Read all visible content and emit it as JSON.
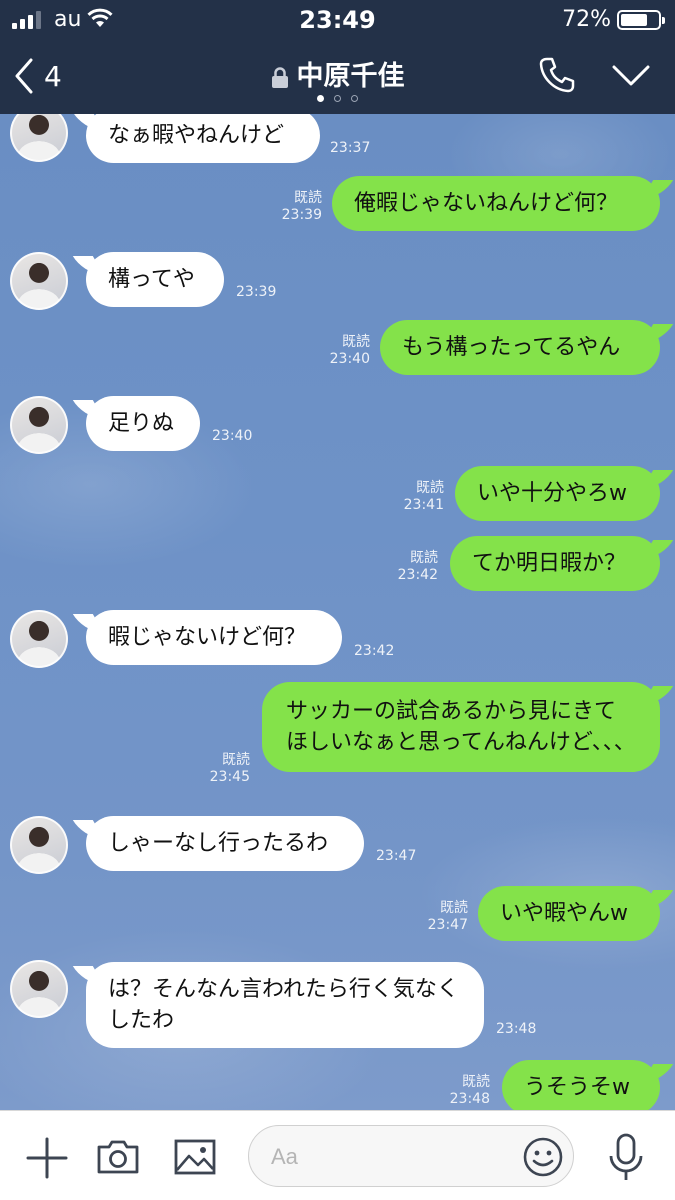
{
  "status_bar": {
    "carrier": "au",
    "time": "23:49",
    "battery_percent": "72%",
    "battery_level": 0.72,
    "signal_bars": 3
  },
  "header": {
    "back_count": "4",
    "contact_name": "中原千佳",
    "lock_icon": "lock-icon",
    "call_icon": "phone-icon",
    "menu_icon": "chevron-down-icon"
  },
  "messages": [
    {
      "side": "in",
      "text": "なぁ暇やねんけど",
      "time": "23:37"
    },
    {
      "side": "out",
      "text": "俺暇じゃないねんけど何？",
      "read": "既読",
      "time": "23:39"
    },
    {
      "side": "in",
      "text": "構ってや",
      "time": "23:39"
    },
    {
      "side": "out",
      "text": "もう構ったってるやん",
      "read": "既読",
      "time": "23:40"
    },
    {
      "side": "in",
      "text": "足りぬ",
      "time": "23:40"
    },
    {
      "side": "out",
      "text": "いや十分やろw",
      "read": "既読",
      "time": "23:41"
    },
    {
      "side": "out",
      "text": "てか明日暇か？",
      "read": "既読",
      "time": "23:42"
    },
    {
      "side": "in",
      "text": "暇じゃないけど何？",
      "time": "23:42"
    },
    {
      "side": "out",
      "text": "サッカーの試合あるから見にきてほしいなぁと思ってんねんけど、、、",
      "read": "既読",
      "time": "23:45"
    },
    {
      "side": "in",
      "text": "しゃーなし行ったるわ",
      "time": "23:47"
    },
    {
      "side": "out",
      "text": "いや暇やんw",
      "read": "既読",
      "time": "23:47"
    },
    {
      "side": "in",
      "text": "は？そんなん言われたら行く気なくしたわ",
      "time": "23:48"
    },
    {
      "side": "out",
      "text": "うそうそw",
      "read": "既読",
      "time": "23:48"
    }
  ],
  "input_bar": {
    "placeholder": "Aa",
    "icons": [
      "plus-icon",
      "camera-icon",
      "image-icon",
      "emoji-icon",
      "microphone-icon"
    ]
  },
  "colors": {
    "header_bg": "#233148",
    "outgoing_bubble": "#84e24a",
    "incoming_bubble": "#ffffff",
    "chat_bg": "#6e92c7"
  }
}
